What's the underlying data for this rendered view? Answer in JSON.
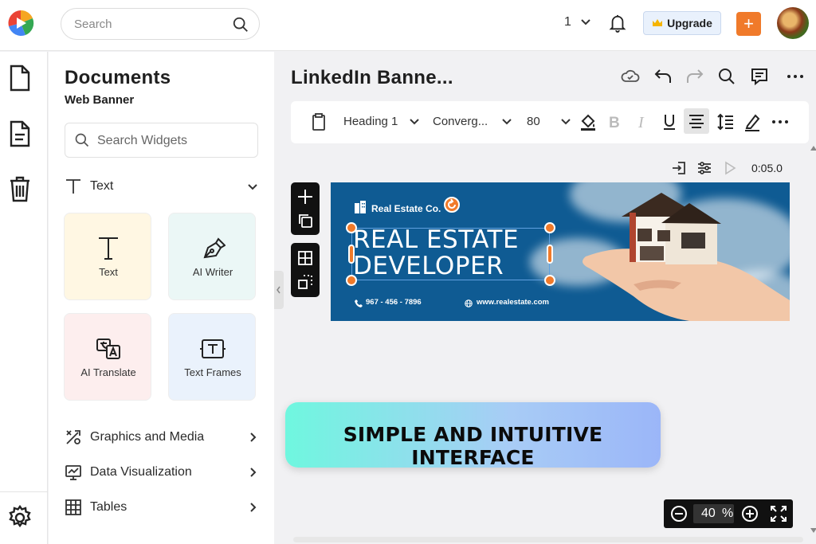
{
  "app": {
    "name": "Document editor"
  },
  "topbar": {
    "search_placeholder": "Search",
    "page_number": "1",
    "upgrade_label": "Upgrade",
    "add_label": "+"
  },
  "rail": {
    "items": [
      "document-icon",
      "file-text-icon",
      "trash-icon"
    ],
    "bottom": "settings-gear-icon"
  },
  "panel": {
    "title": "Documents",
    "subtitle": "Web Banner",
    "search_placeholder": "Search Widgets",
    "text_section": "Text",
    "cards": [
      {
        "label": "Text",
        "icon": "text-t-icon",
        "color": "#fff7e3"
      },
      {
        "label": "AI Writer",
        "icon": "pen-nib-icon",
        "color": "#ebf7f6"
      },
      {
        "label": "AI Translate",
        "icon": "translate-icon",
        "color": "#fdeeee"
      },
      {
        "label": "Text Frames",
        "icon": "text-frame-icon",
        "color": "#eaf2fc"
      }
    ],
    "sections": [
      {
        "label": "Graphics and Media",
        "icon": "graphics-icon"
      },
      {
        "label": "Data Visualization",
        "icon": "chart-icon"
      },
      {
        "label": "Tables",
        "icon": "table-icon"
      }
    ]
  },
  "editor": {
    "doc_title": "LinkedIn Banne...",
    "toolbar": {
      "style": "Heading 1",
      "font": "Converg...",
      "size": "80"
    },
    "timer": "0:05.0"
  },
  "banner": {
    "brand": "Real Estate Co.",
    "headline_line1": "REAL ESTATE",
    "headline_line2": "DEVELOPER",
    "phone": "967 - 456 - 7896",
    "website": "www.realestate.com",
    "bg_color": "#0f5b93"
  },
  "promo": {
    "text": "SIMPLE AND INTUITIVE INTERFACE"
  },
  "zoom": {
    "value": "40",
    "unit": "%"
  },
  "colors": {
    "accent": "#f07a2a",
    "upgrade_bg": "#e9f1fc"
  }
}
